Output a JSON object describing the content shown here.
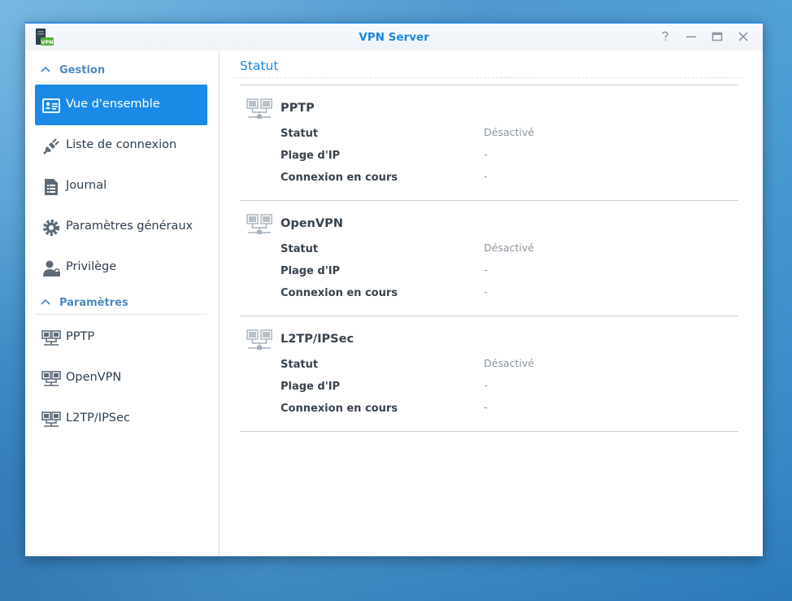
{
  "window": {
    "title": "VPN Server",
    "app_icon_badge": "VPN",
    "controls": [
      "help",
      "minimize",
      "maximize",
      "close"
    ]
  },
  "sidebar": {
    "sections": [
      {
        "label": "Gestion",
        "items": [
          {
            "label": "Vue d'ensemble",
            "icon": "overview-icon",
            "active": true
          },
          {
            "label": "Liste de connexion",
            "icon": "plug-icon"
          },
          {
            "label": "Journal",
            "icon": "log-icon"
          },
          {
            "label": "Paramètres généraux",
            "icon": "gear-icon"
          },
          {
            "label": "Privilège",
            "icon": "user-lock-icon"
          }
        ]
      },
      {
        "label": "Paramètres",
        "items": [
          {
            "label": "PPTP",
            "icon": "network-icon"
          },
          {
            "label": "OpenVPN",
            "icon": "network-icon"
          },
          {
            "label": "L2TP/IPSec",
            "icon": "network-icon"
          }
        ]
      }
    ]
  },
  "main": {
    "title": "Statut",
    "blocks": [
      {
        "name": "PPTP",
        "rows": [
          {
            "label": "Statut",
            "value": "Désactivé"
          },
          {
            "label": "Plage d'IP",
            "value": "-"
          },
          {
            "label": "Connexion en cours",
            "value": "-"
          }
        ]
      },
      {
        "name": "OpenVPN",
        "rows": [
          {
            "label": "Statut",
            "value": "Désactivé"
          },
          {
            "label": "Plage d'IP",
            "value": "-"
          },
          {
            "label": "Connexion en cours",
            "value": "-"
          }
        ]
      },
      {
        "name": "L2TP/IPSec",
        "rows": [
          {
            "label": "Statut",
            "value": "Désactivé"
          },
          {
            "label": "Plage d'IP",
            "value": "-"
          },
          {
            "label": "Connexion en cours",
            "value": "-"
          }
        ]
      }
    ]
  },
  "colors": {
    "accent": "#1e87db",
    "active_item": "#1a8ae6",
    "section_header": "#4e8ac0"
  }
}
